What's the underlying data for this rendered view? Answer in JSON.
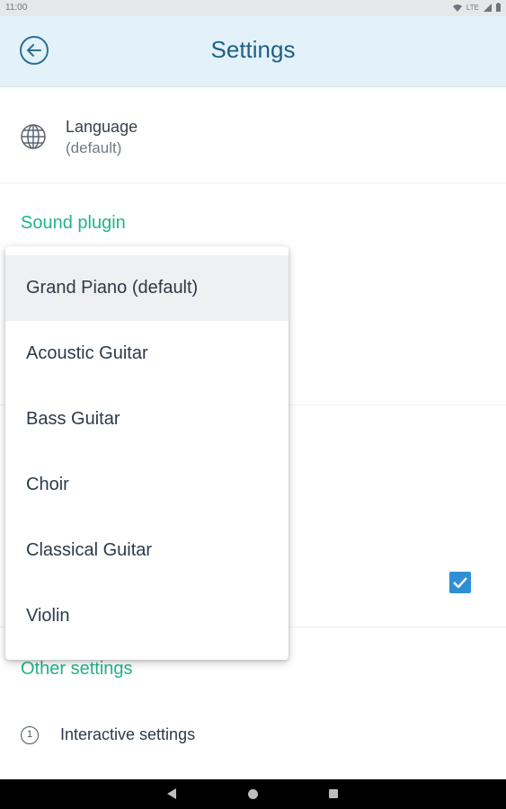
{
  "status_bar": {
    "time": "11:00",
    "network": "LTE"
  },
  "app_bar": {
    "title": "Settings"
  },
  "language": {
    "title": "Language",
    "value": "(default)"
  },
  "sections": {
    "sound_plugin": "Sound plugin",
    "other_settings": "Other settings"
  },
  "dropdown": {
    "options": [
      "Grand Piano (default)",
      "Acoustic Guitar",
      "Bass Guitar",
      "Choir",
      "Classical Guitar",
      "Violin"
    ],
    "selected": "Grand Piano (default)"
  },
  "checkbox": {
    "checked": true
  },
  "interactive_settings": {
    "number": "1",
    "label": "Interactive settings"
  },
  "colors": {
    "accent": "#21b38a",
    "primary": "#1f5f86",
    "checkbox": "#2e8fd5",
    "app_bar_bg": "#e3f2f9"
  }
}
